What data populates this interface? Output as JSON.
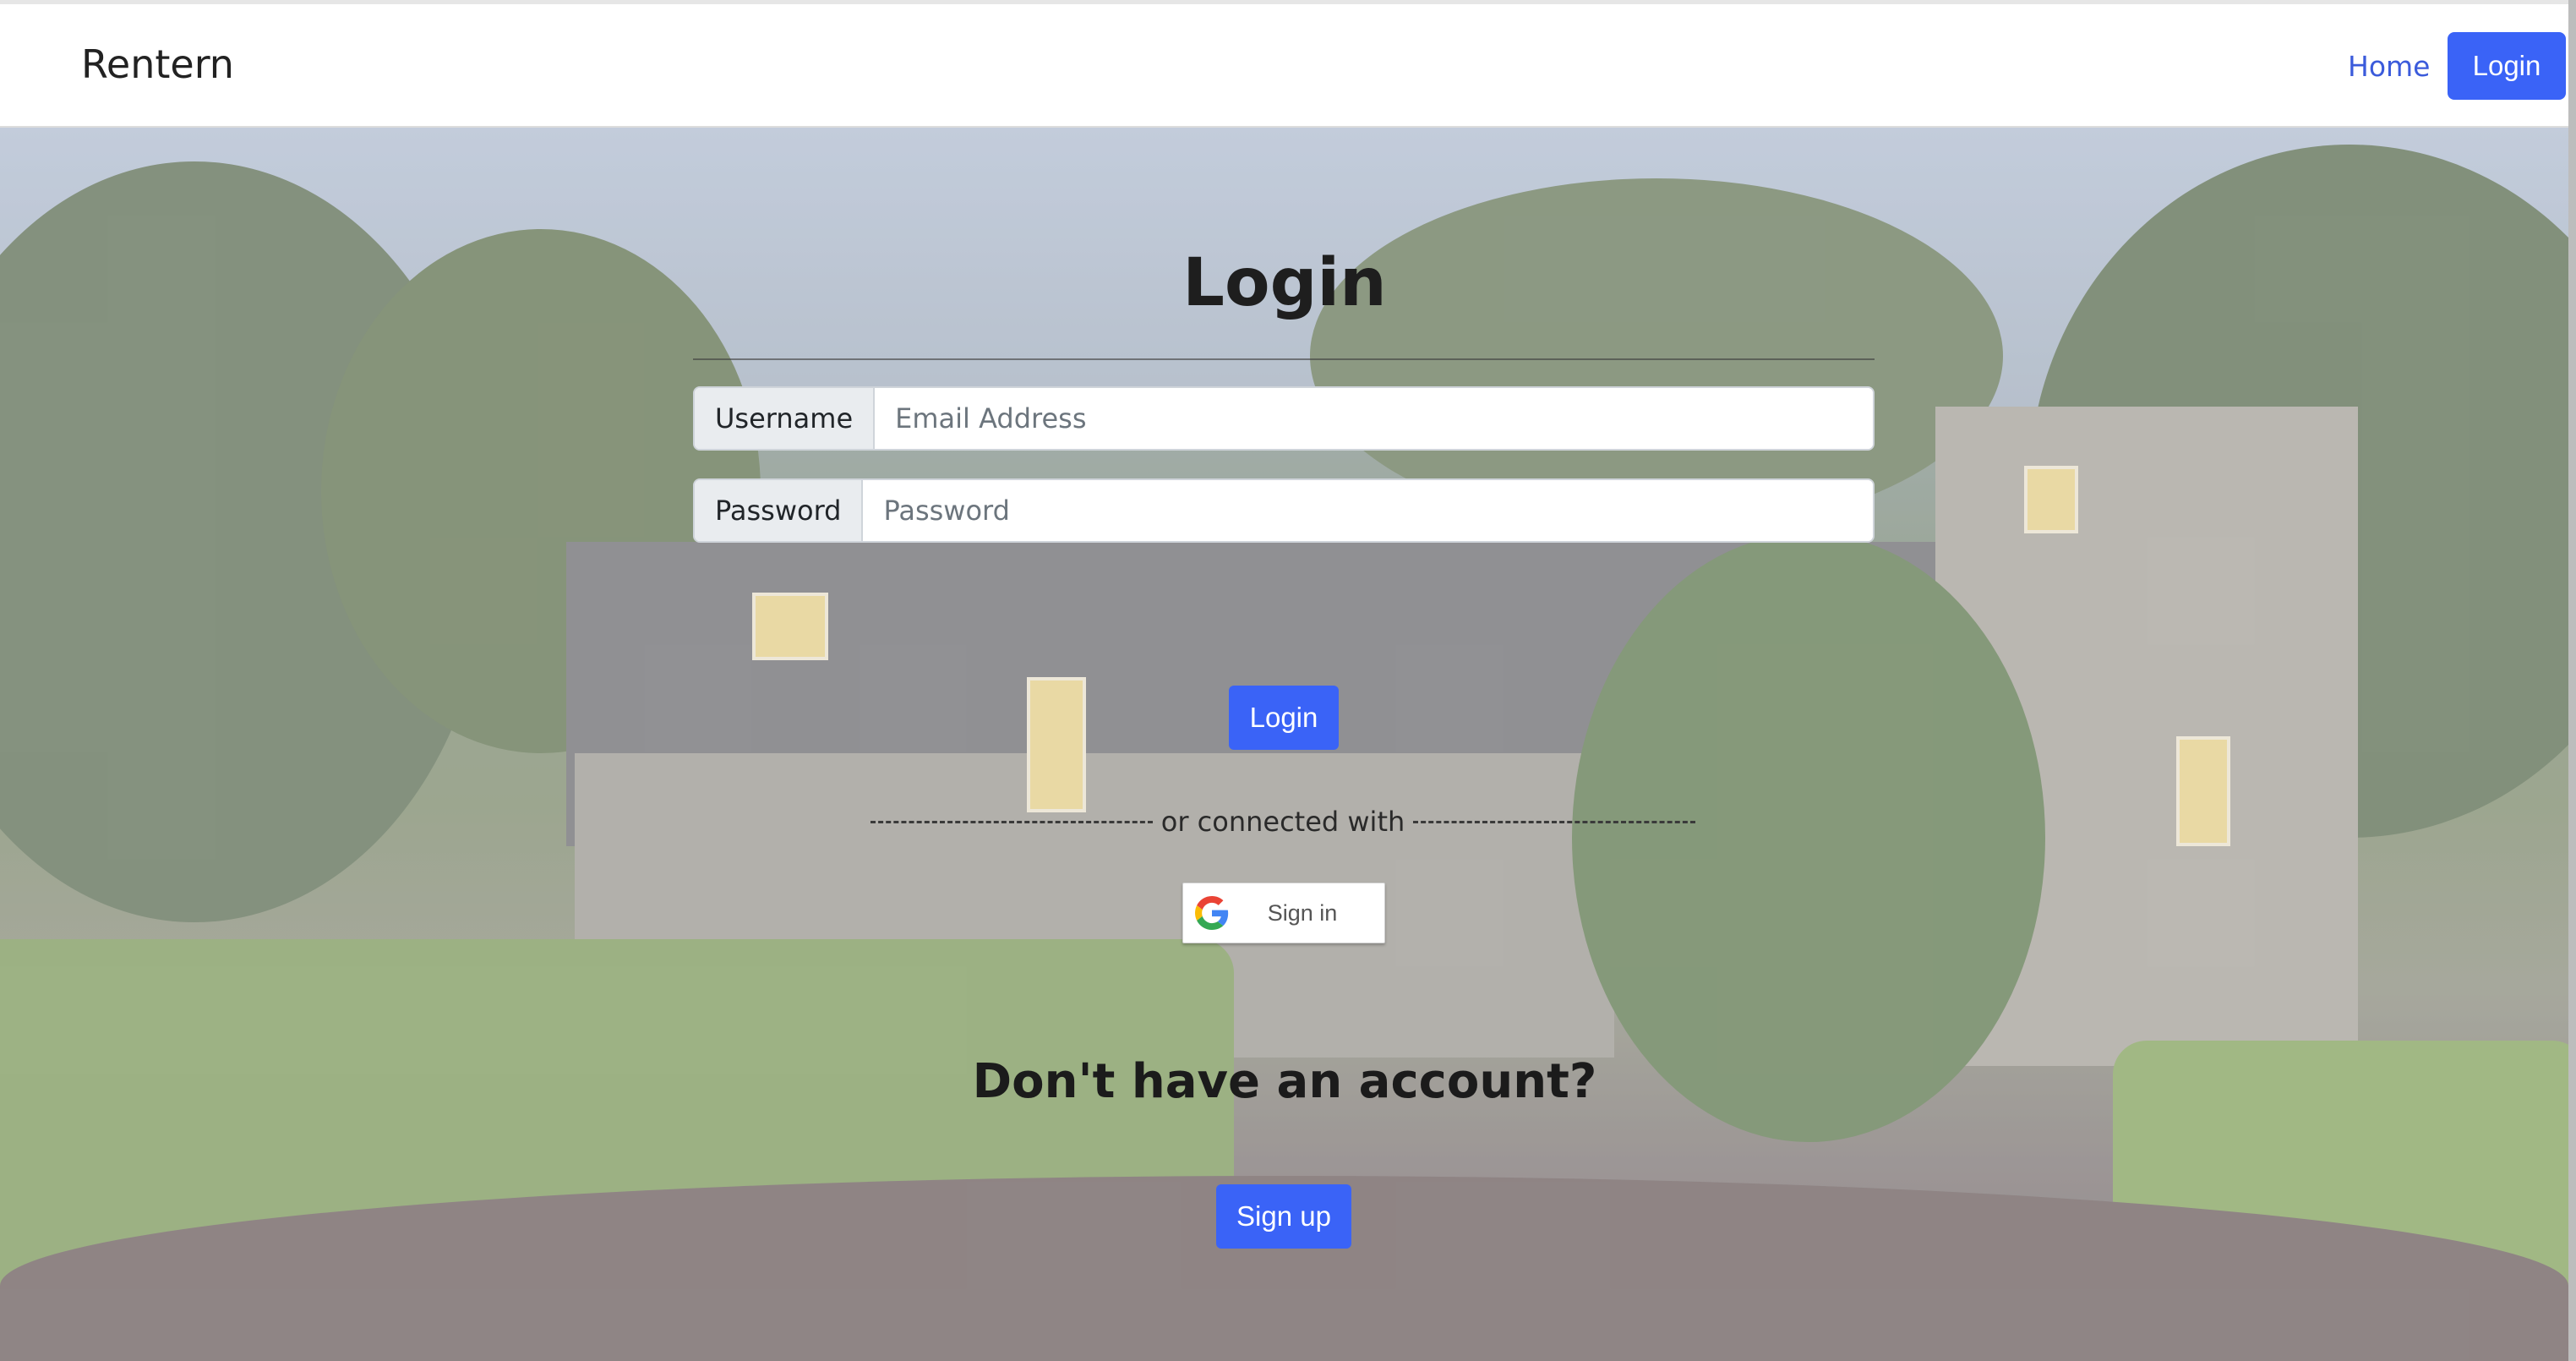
{
  "navbar": {
    "brand": "Rentern",
    "home_label": "Home",
    "login_label": "Login"
  },
  "form": {
    "title": "Login",
    "username_label": "Username",
    "username_placeholder": "Email Address",
    "password_label": "Password",
    "password_placeholder": "Password",
    "login_button": "Login",
    "divider_text": "or connected with",
    "google_button": "Sign in"
  },
  "signup": {
    "prompt": "Don't have an account?",
    "button": "Sign up"
  },
  "colors": {
    "accent": "#3a63f7",
    "link": "#3b5bdb"
  },
  "icons": {
    "google": "google-g-icon"
  }
}
